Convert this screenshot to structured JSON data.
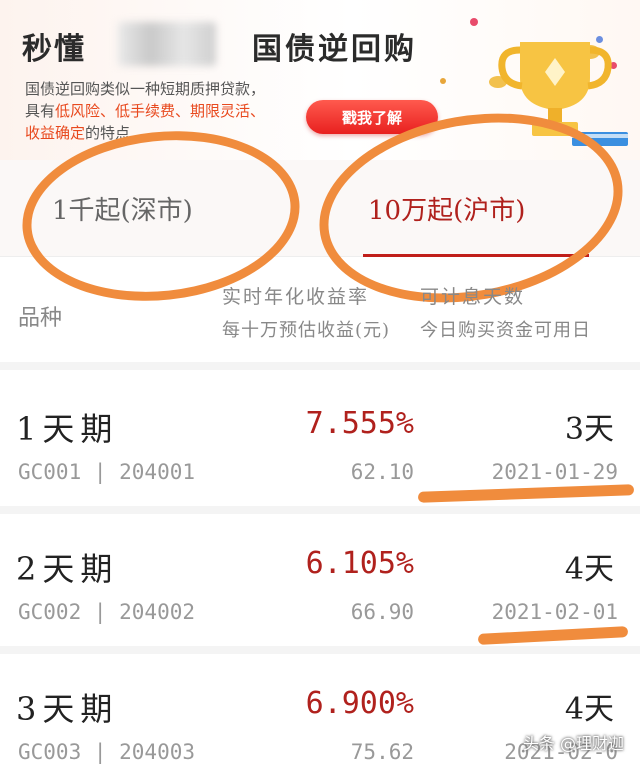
{
  "banner": {
    "title_left": "秒懂",
    "title_right": "国债逆回购",
    "desc_line1": "国债逆回购类似一种短期质押贷款，",
    "desc_prefix": "具有",
    "desc_h1": "低风险、",
    "desc_h2": "低手续费、",
    "desc_h3": "期限灵活、",
    "desc_h4": "收益确定",
    "desc_suffix": "的特点",
    "button": "戳我了解"
  },
  "tabs": [
    {
      "label": "1千起(深市)"
    },
    {
      "label": "10万起(沪市)"
    }
  ],
  "header": {
    "variety": "品种",
    "rate": "实时年化收益率",
    "days": "可计息天数",
    "est": "每十万预估收益(元)",
    "fund": "今日购买资金可用日"
  },
  "rows": [
    {
      "name": "1天期",
      "code": "GC001 | 204001",
      "rate": "7.555%",
      "est": "62.10",
      "days": "3天",
      "date": "2021-01-29"
    },
    {
      "name": "2天期",
      "code": "GC002 | 204002",
      "rate": "6.105%",
      "est": "66.90",
      "days": "4天",
      "date": "2021-02-01"
    },
    {
      "name": "3天期",
      "code": "GC003 | 204003",
      "rate": "6.900%",
      "est": "75.62",
      "days": "4天",
      "date": "2021-02-0"
    }
  ],
  "watermark": "头条 @理财迦",
  "colors": {
    "accent": "#b0211d",
    "annotation": "#f08c3d",
    "button": "#e8201f"
  }
}
